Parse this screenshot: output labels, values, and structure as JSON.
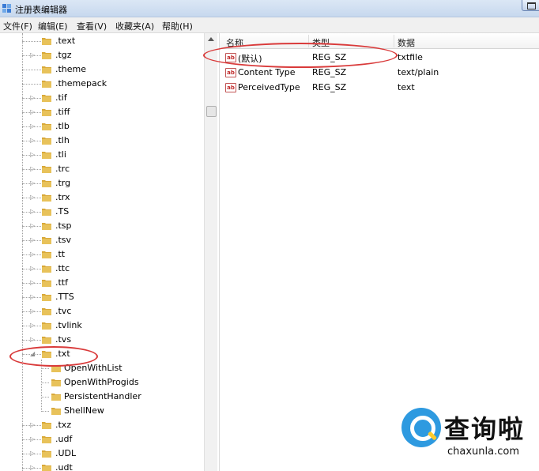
{
  "window": {
    "title": "注册表编辑器"
  },
  "menu": [
    "文件(F)",
    "编辑(E)",
    "查看(V)",
    "收藏夹(A)",
    "帮助(H)"
  ],
  "tree": {
    "items": [
      {
        "label": ".text",
        "expander": "",
        "depth": 0
      },
      {
        "label": ".tgz",
        "expander": "▷",
        "depth": 0
      },
      {
        "label": ".theme",
        "expander": "",
        "depth": 0
      },
      {
        "label": ".themepack",
        "expander": "",
        "depth": 0
      },
      {
        "label": ".tif",
        "expander": "▷",
        "depth": 0
      },
      {
        "label": ".tiff",
        "expander": "▷",
        "depth": 0
      },
      {
        "label": ".tlb",
        "expander": "▷",
        "depth": 0
      },
      {
        "label": ".tlh",
        "expander": "▷",
        "depth": 0
      },
      {
        "label": ".tli",
        "expander": "▷",
        "depth": 0
      },
      {
        "label": ".trc",
        "expander": "▷",
        "depth": 0
      },
      {
        "label": ".trg",
        "expander": "▷",
        "depth": 0
      },
      {
        "label": ".trx",
        "expander": "▷",
        "depth": 0
      },
      {
        "label": ".TS",
        "expander": "▷",
        "depth": 0
      },
      {
        "label": ".tsp",
        "expander": "▷",
        "depth": 0
      },
      {
        "label": ".tsv",
        "expander": "▷",
        "depth": 0
      },
      {
        "label": ".tt",
        "expander": "▷",
        "depth": 0
      },
      {
        "label": ".ttc",
        "expander": "▷",
        "depth": 0
      },
      {
        "label": ".ttf",
        "expander": "▷",
        "depth": 0
      },
      {
        "label": ".TTS",
        "expander": "▷",
        "depth": 0
      },
      {
        "label": ".tvc",
        "expander": "▷",
        "depth": 0
      },
      {
        "label": ".tvlink",
        "expander": "▷",
        "depth": 0
      },
      {
        "label": ".tvs",
        "expander": "▷",
        "depth": 0
      },
      {
        "label": ".txt",
        "expander": "◢",
        "depth": 0
      },
      {
        "label": "OpenWithList",
        "expander": "",
        "depth": 1
      },
      {
        "label": "OpenWithProgids",
        "expander": "",
        "depth": 1
      },
      {
        "label": "PersistentHandler",
        "expander": "",
        "depth": 1
      },
      {
        "label": "ShellNew",
        "expander": "",
        "depth": 1
      },
      {
        "label": ".txz",
        "expander": "▷",
        "depth": 0
      },
      {
        "label": ".udf",
        "expander": "▷",
        "depth": 0
      },
      {
        "label": ".UDL",
        "expander": "▷",
        "depth": 0
      },
      {
        "label": ".udt",
        "expander": "▷",
        "depth": 0
      }
    ]
  },
  "list": {
    "headers": {
      "name": "名称",
      "type": "类型",
      "data": "数据"
    },
    "rows": [
      {
        "icon": "ab",
        "name": "(默认)",
        "type": "REG_SZ",
        "data": "txtfile"
      },
      {
        "icon": "ab",
        "name": "Content Type",
        "type": "REG_SZ",
        "data": "text/plain"
      },
      {
        "icon": "ab",
        "name": "PerceivedType",
        "type": "REG_SZ",
        "data": "text"
      }
    ]
  },
  "watermark": {
    "cn": "查询啦",
    "en": "chaxunla.com"
  },
  "colors": {
    "annotation": "#d93a3a",
    "folder": "#e8c25a",
    "logo": "#2e9ae0"
  }
}
